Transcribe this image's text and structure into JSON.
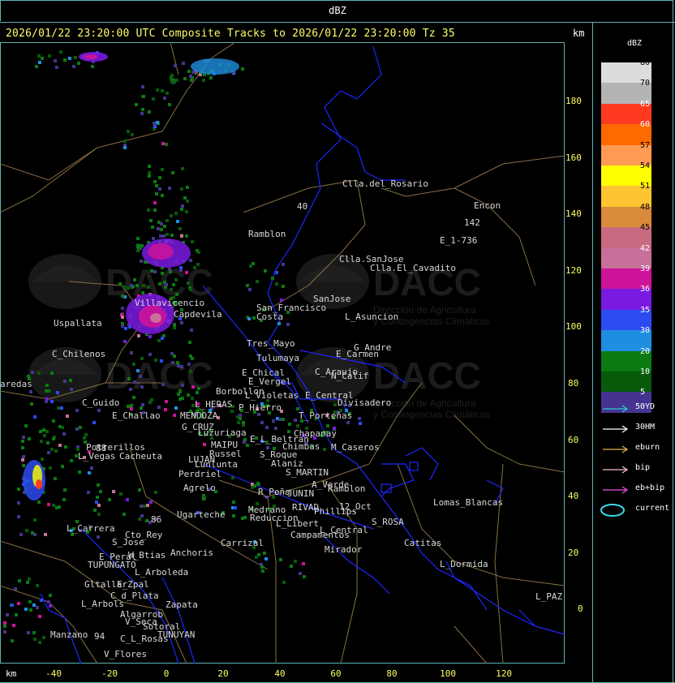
{
  "header": {
    "top_title": "dBZ",
    "main_title": "2026/01/22 23:20:00 UTC Composite Tracks to 2026/01/22 23:20:00 Tz 35",
    "km_label_top": "km",
    "km_label_bottom": "km"
  },
  "axes": {
    "x_ticks": [
      "-40",
      "-20",
      "0",
      "20",
      "40",
      "60",
      "80",
      "100",
      "120"
    ],
    "y_ticks": [
      "180",
      "160",
      "140",
      "120",
      "100",
      "80",
      "60",
      "40",
      "20",
      "0"
    ]
  },
  "colors": {
    "frame": "#5fb3b3",
    "tick": "#ffff66",
    "province_border": "#1d27ff",
    "department_border": "#8a6f45"
  },
  "watermark": {
    "brand": "DACC",
    "line1": "Dirección de Agricultura",
    "line2": "y Contingencias Climáticas"
  },
  "places": [
    {
      "name": "Clla.del_Rosario"
    },
    {
      "name": "Encon"
    },
    {
      "name": "142"
    },
    {
      "name": "E_1-736"
    },
    {
      "name": "Ramblon"
    },
    {
      "name": "40"
    },
    {
      "name": "Clla.SanJose"
    },
    {
      "name": "Clla.El_Cavadito"
    },
    {
      "name": "Villavicencio"
    },
    {
      "name": "Uspallata"
    },
    {
      "name": "Capdevila"
    },
    {
      "name": "San_Francisco"
    },
    {
      "name": "SanJose"
    },
    {
      "name": "L_Asuncion"
    },
    {
      "name": "Costa"
    },
    {
      "name": "Tres_Mayo"
    },
    {
      "name": "C_Chilenos"
    },
    {
      "name": "Tulumaya"
    },
    {
      "name": "G_Andre"
    },
    {
      "name": "E_Carmen"
    },
    {
      "name": "E_Chical"
    },
    {
      "name": "E_Vergel"
    },
    {
      "name": "C_Araujo"
    },
    {
      "name": "N_Calif"
    },
    {
      "name": "aredas"
    },
    {
      "name": "Borbollon"
    },
    {
      "name": "L_Violetas"
    },
    {
      "name": "E_Central"
    },
    {
      "name": "Divisadero"
    },
    {
      "name": "C_Guido"
    },
    {
      "name": "L_HERAS"
    },
    {
      "name": "P_Hierro"
    },
    {
      "name": "E_Challao"
    },
    {
      "name": "MENDOZA"
    },
    {
      "name": "T_Porteñas"
    },
    {
      "name": "G_CRUZ"
    },
    {
      "name": "Luzuriaga"
    },
    {
      "name": "E_L_Beltran"
    },
    {
      "name": "Chapanay"
    },
    {
      "name": "Potrerillos"
    },
    {
      "name": "MAIPU"
    },
    {
      "name": "Chimbas"
    },
    {
      "name": "M_Caseros"
    },
    {
      "name": "L_Vegas"
    },
    {
      "name": "Cacheuta"
    },
    {
      "name": "Russel"
    },
    {
      "name": "S_Roque"
    },
    {
      "name": "LUJAN"
    },
    {
      "name": "Lunlunta"
    },
    {
      "name": "Alaniz"
    },
    {
      "name": "S_MARTIN"
    },
    {
      "name": "Perdriel"
    },
    {
      "name": "A_Verde"
    },
    {
      "name": "Agrelo"
    },
    {
      "name": "R_Peña"
    },
    {
      "name": "JUNIN"
    },
    {
      "name": "Ramblon"
    },
    {
      "name": "Lomas_Blancas"
    },
    {
      "name": "12_Oct"
    },
    {
      "name": "Medrano"
    },
    {
      "name": "RIVAD"
    },
    {
      "name": "Phillips"
    },
    {
      "name": "Ugarteche"
    },
    {
      "name": "Reduccion"
    },
    {
      "name": "S_ROSA"
    },
    {
      "name": "L_Libert"
    },
    {
      "name": "L_Carrera"
    },
    {
      "name": "Cto_Rey"
    },
    {
      "name": "L_Central"
    },
    {
      "name": "S_Jose"
    },
    {
      "name": "Campamentos"
    },
    {
      "name": "Catitas"
    },
    {
      "name": "Carrizal"
    },
    {
      "name": "Anchoris"
    },
    {
      "name": "W_Btias"
    },
    {
      "name": "E_Peral"
    },
    {
      "name": "Mirador"
    },
    {
      "name": "TUPUNGATO"
    },
    {
      "name": "L_Arboleda"
    },
    {
      "name": "L_Dormida"
    },
    {
      "name": "Gltallar"
    },
    {
      "name": "E_Zpal"
    },
    {
      "name": "L_PAZ"
    },
    {
      "name": "L_Arbols"
    },
    {
      "name": "C_d_Plata"
    },
    {
      "name": "Zapata"
    },
    {
      "name": "Algarrob"
    },
    {
      "name": "Sotoral"
    },
    {
      "name": "V_Seca"
    },
    {
      "name": "TUNUYAN"
    },
    {
      "name": "Manzano"
    },
    {
      "name": "94"
    },
    {
      "name": "C_L_Rosas"
    },
    {
      "name": "V_Flores"
    },
    {
      "name": "88"
    },
    {
      "name": "86"
    }
  ],
  "legend": {
    "title": "dBZ",
    "items": [
      {
        "label": "80",
        "color": "#dcdcdc"
      },
      {
        "label": "70",
        "color": "#b4b4b4"
      },
      {
        "label": "65",
        "color": "#ff3a20"
      },
      {
        "label": "60",
        "color": "#ff6a00"
      },
      {
        "label": "57",
        "color": "#ff9a55"
      },
      {
        "label": "54",
        "color": "#ffff00"
      },
      {
        "label": "51",
        "color": "#fcc531"
      },
      {
        "label": "48",
        "color": "#d98a3a"
      },
      {
        "label": "45",
        "color": "#c86a80"
      },
      {
        "label": "42",
        "color": "#c8709a"
      },
      {
        "label": "39",
        "color": "#cc1399"
      },
      {
        "label": "36",
        "color": "#7a1ae0"
      },
      {
        "label": "35",
        "color": "#2b4cf0"
      },
      {
        "label": "30",
        "color": "#1f8ee0"
      },
      {
        "label": "20",
        "color": "#0b7a12"
      },
      {
        "label": "10",
        "color": "#085a0a"
      },
      {
        "label": "5",
        "color": "#45348f"
      }
    ]
  },
  "tracks": [
    {
      "label": "50YD",
      "color": "#2ec9ce"
    },
    {
      "label": "30HM",
      "color": "#ffffff"
    },
    {
      "label": "eburn",
      "color": "#e8b84a"
    },
    {
      "label": "bip",
      "color": "#ffc0cb"
    },
    {
      "label": "eb+bip",
      "color": "#ee55ee"
    },
    {
      "label": "current",
      "color": "#3ad9e8"
    }
  ]
}
